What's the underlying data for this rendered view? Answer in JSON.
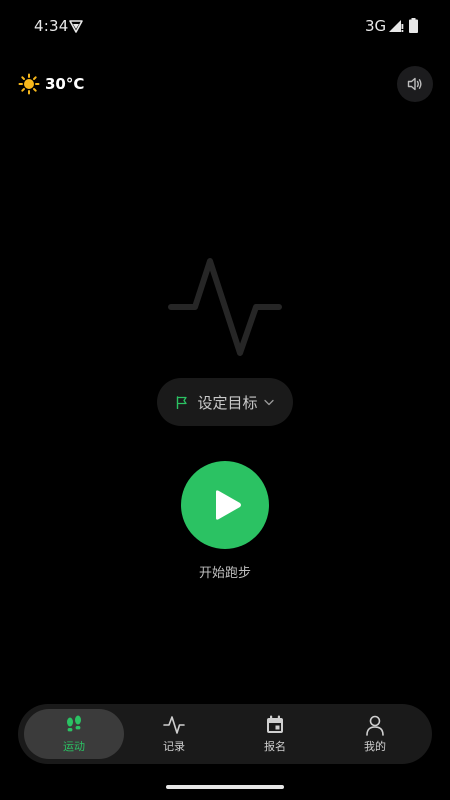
{
  "status_bar": {
    "time": "4:34",
    "network": "3G",
    "icons": [
      "vpn-icon",
      "signal-icon",
      "battery-icon"
    ]
  },
  "header": {
    "weather_icon": "sun-icon",
    "temperature": "30°C",
    "sound_icon": "speaker-icon"
  },
  "main": {
    "center_icon": "pulse-icon",
    "goal_label": "设定目标",
    "goal_icons": [
      "flag-icon",
      "chevron-down-icon"
    ],
    "start_icon": "play-icon",
    "start_label": "开始跑步"
  },
  "bottom_nav": {
    "items": [
      {
        "label": "运动",
        "icon": "footprints-icon",
        "active": true
      },
      {
        "label": "记录",
        "icon": "activity-icon",
        "active": false
      },
      {
        "label": "报名",
        "icon": "calendar-icon",
        "active": false
      },
      {
        "label": "我的",
        "icon": "user-icon",
        "active": false
      }
    ]
  },
  "colors": {
    "background": "#000000",
    "accent": "#2bc263",
    "surface": "#1a1a1a",
    "active_tab": "#3b3b3b"
  }
}
